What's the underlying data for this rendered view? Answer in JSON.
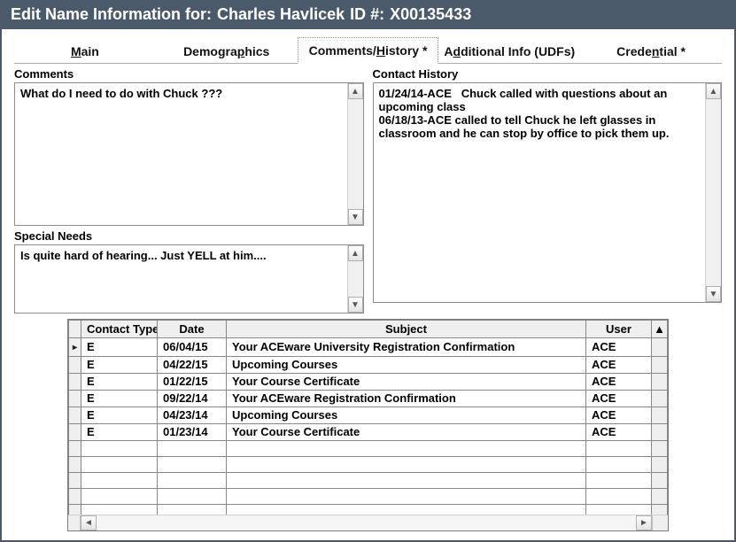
{
  "title": {
    "prefix": "Edit Name Information for:",
    "name": "Charles Havlicek",
    "id_label": "ID #:",
    "id_value": "X00135433"
  },
  "tabs": [
    {
      "pre": "",
      "hot": "M",
      "post": "ain"
    },
    {
      "pre": "Demogra",
      "hot": "p",
      "post": "hics"
    },
    {
      "pre": "Comments/",
      "hot": "H",
      "post": "istory *"
    },
    {
      "pre": "A",
      "hot": "d",
      "post": "ditional Info (UDFs)"
    },
    {
      "pre": "Crede",
      "hot": "n",
      "post": "tial *"
    }
  ],
  "active_tab_index": 2,
  "labels": {
    "comments": "Comments",
    "special": "Special Needs",
    "contact_history": "Contact History"
  },
  "comments_text": "What do I need to do with Chuck ???",
  "special_text": "Is quite hard of hearing... Just YELL at him....",
  "contact_history_text": "01/24/14-ACE   Chuck called with questions about an upcoming class\n06/18/13-ACE called to tell Chuck he left glasses in classroom and he can stop by office to pick them up.",
  "grid": {
    "columns": [
      "Contact Type",
      "Date",
      "Subject",
      "User"
    ],
    "rows": [
      {
        "ct": "E",
        "date": "06/04/15",
        "subject": "Your ACEware University Registration Confirmation",
        "user": "ACE"
      },
      {
        "ct": "E",
        "date": "04/22/15",
        "subject": "Upcoming Courses",
        "user": "ACE"
      },
      {
        "ct": "E",
        "date": "01/22/15",
        "subject": "Your Course Certificate",
        "user": "ACE"
      },
      {
        "ct": "E",
        "date": "09/22/14",
        "subject": "Your ACEware Registration Confirmation",
        "user": "ACE"
      },
      {
        "ct": "E",
        "date": "04/23/14",
        "subject": "Upcoming Courses",
        "user": "ACE"
      },
      {
        "ct": "E",
        "date": "01/23/14",
        "subject": "Your Course Certificate",
        "user": "ACE"
      }
    ],
    "blank_rows": 5
  }
}
